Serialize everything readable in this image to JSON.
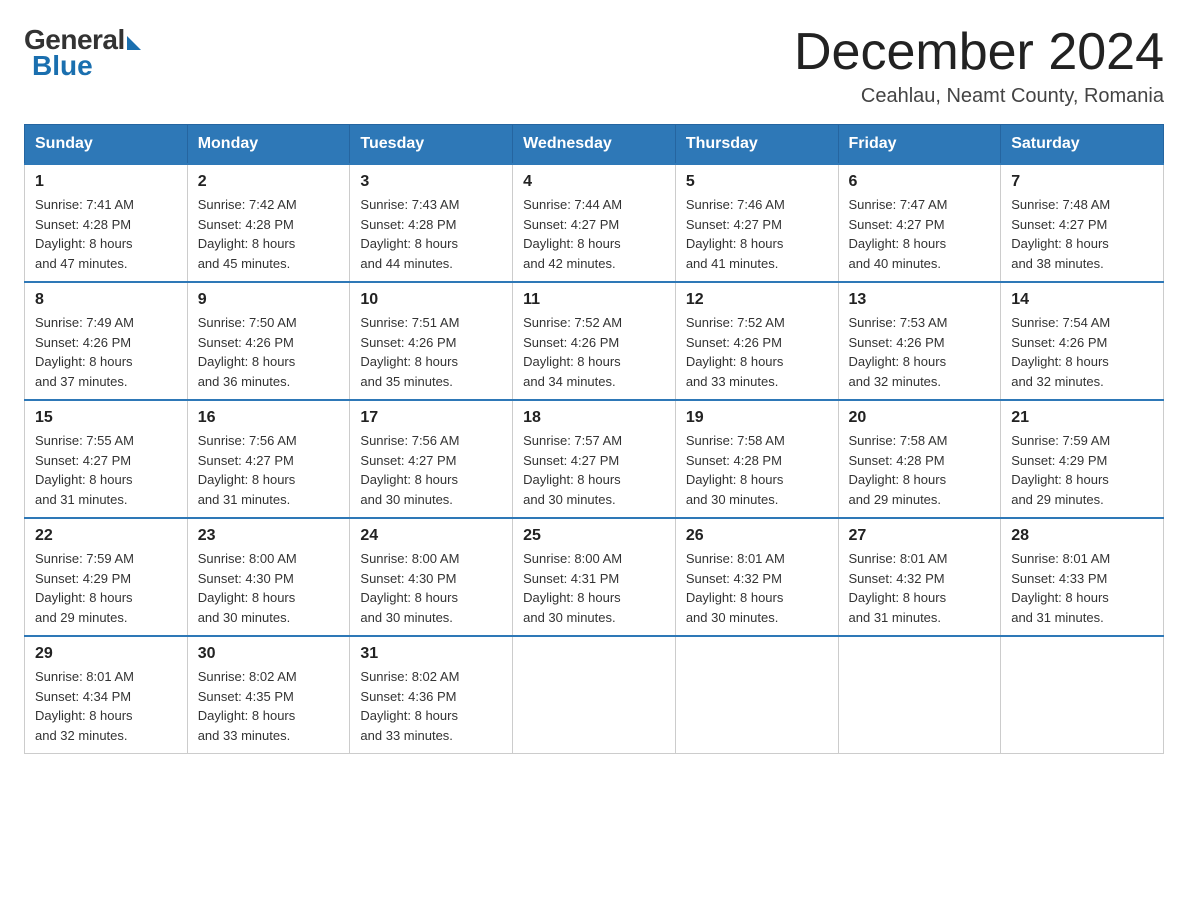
{
  "header": {
    "logo_general": "General",
    "logo_blue": "Blue",
    "month_title": "December 2024",
    "subtitle": "Ceahlau, Neamt County, Romania"
  },
  "days_of_week": [
    "Sunday",
    "Monday",
    "Tuesday",
    "Wednesday",
    "Thursday",
    "Friday",
    "Saturday"
  ],
  "weeks": [
    [
      {
        "day": "1",
        "sunrise": "7:41 AM",
        "sunset": "4:28 PM",
        "daylight": "8 hours and 47 minutes."
      },
      {
        "day": "2",
        "sunrise": "7:42 AM",
        "sunset": "4:28 PM",
        "daylight": "8 hours and 45 minutes."
      },
      {
        "day": "3",
        "sunrise": "7:43 AM",
        "sunset": "4:28 PM",
        "daylight": "8 hours and 44 minutes."
      },
      {
        "day": "4",
        "sunrise": "7:44 AM",
        "sunset": "4:27 PM",
        "daylight": "8 hours and 42 minutes."
      },
      {
        "day": "5",
        "sunrise": "7:46 AM",
        "sunset": "4:27 PM",
        "daylight": "8 hours and 41 minutes."
      },
      {
        "day": "6",
        "sunrise": "7:47 AM",
        "sunset": "4:27 PM",
        "daylight": "8 hours and 40 minutes."
      },
      {
        "day": "7",
        "sunrise": "7:48 AM",
        "sunset": "4:27 PM",
        "daylight": "8 hours and 38 minutes."
      }
    ],
    [
      {
        "day": "8",
        "sunrise": "7:49 AM",
        "sunset": "4:26 PM",
        "daylight": "8 hours and 37 minutes."
      },
      {
        "day": "9",
        "sunrise": "7:50 AM",
        "sunset": "4:26 PM",
        "daylight": "8 hours and 36 minutes."
      },
      {
        "day": "10",
        "sunrise": "7:51 AM",
        "sunset": "4:26 PM",
        "daylight": "8 hours and 35 minutes."
      },
      {
        "day": "11",
        "sunrise": "7:52 AM",
        "sunset": "4:26 PM",
        "daylight": "8 hours and 34 minutes."
      },
      {
        "day": "12",
        "sunrise": "7:52 AM",
        "sunset": "4:26 PM",
        "daylight": "8 hours and 33 minutes."
      },
      {
        "day": "13",
        "sunrise": "7:53 AM",
        "sunset": "4:26 PM",
        "daylight": "8 hours and 32 minutes."
      },
      {
        "day": "14",
        "sunrise": "7:54 AM",
        "sunset": "4:26 PM",
        "daylight": "8 hours and 32 minutes."
      }
    ],
    [
      {
        "day": "15",
        "sunrise": "7:55 AM",
        "sunset": "4:27 PM",
        "daylight": "8 hours and 31 minutes."
      },
      {
        "day": "16",
        "sunrise": "7:56 AM",
        "sunset": "4:27 PM",
        "daylight": "8 hours and 31 minutes."
      },
      {
        "day": "17",
        "sunrise": "7:56 AM",
        "sunset": "4:27 PM",
        "daylight": "8 hours and 30 minutes."
      },
      {
        "day": "18",
        "sunrise": "7:57 AM",
        "sunset": "4:27 PM",
        "daylight": "8 hours and 30 minutes."
      },
      {
        "day": "19",
        "sunrise": "7:58 AM",
        "sunset": "4:28 PM",
        "daylight": "8 hours and 30 minutes."
      },
      {
        "day": "20",
        "sunrise": "7:58 AM",
        "sunset": "4:28 PM",
        "daylight": "8 hours and 29 minutes."
      },
      {
        "day": "21",
        "sunrise": "7:59 AM",
        "sunset": "4:29 PM",
        "daylight": "8 hours and 29 minutes."
      }
    ],
    [
      {
        "day": "22",
        "sunrise": "7:59 AM",
        "sunset": "4:29 PM",
        "daylight": "8 hours and 29 minutes."
      },
      {
        "day": "23",
        "sunrise": "8:00 AM",
        "sunset": "4:30 PM",
        "daylight": "8 hours and 30 minutes."
      },
      {
        "day": "24",
        "sunrise": "8:00 AM",
        "sunset": "4:30 PM",
        "daylight": "8 hours and 30 minutes."
      },
      {
        "day": "25",
        "sunrise": "8:00 AM",
        "sunset": "4:31 PM",
        "daylight": "8 hours and 30 minutes."
      },
      {
        "day": "26",
        "sunrise": "8:01 AM",
        "sunset": "4:32 PM",
        "daylight": "8 hours and 30 minutes."
      },
      {
        "day": "27",
        "sunrise": "8:01 AM",
        "sunset": "4:32 PM",
        "daylight": "8 hours and 31 minutes."
      },
      {
        "day": "28",
        "sunrise": "8:01 AM",
        "sunset": "4:33 PM",
        "daylight": "8 hours and 31 minutes."
      }
    ],
    [
      {
        "day": "29",
        "sunrise": "8:01 AM",
        "sunset": "4:34 PM",
        "daylight": "8 hours and 32 minutes."
      },
      {
        "day": "30",
        "sunrise": "8:02 AM",
        "sunset": "4:35 PM",
        "daylight": "8 hours and 33 minutes."
      },
      {
        "day": "31",
        "sunrise": "8:02 AM",
        "sunset": "4:36 PM",
        "daylight": "8 hours and 33 minutes."
      },
      null,
      null,
      null,
      null
    ]
  ],
  "labels": {
    "sunrise": "Sunrise: ",
    "sunset": "Sunset: ",
    "daylight": "Daylight: "
  }
}
